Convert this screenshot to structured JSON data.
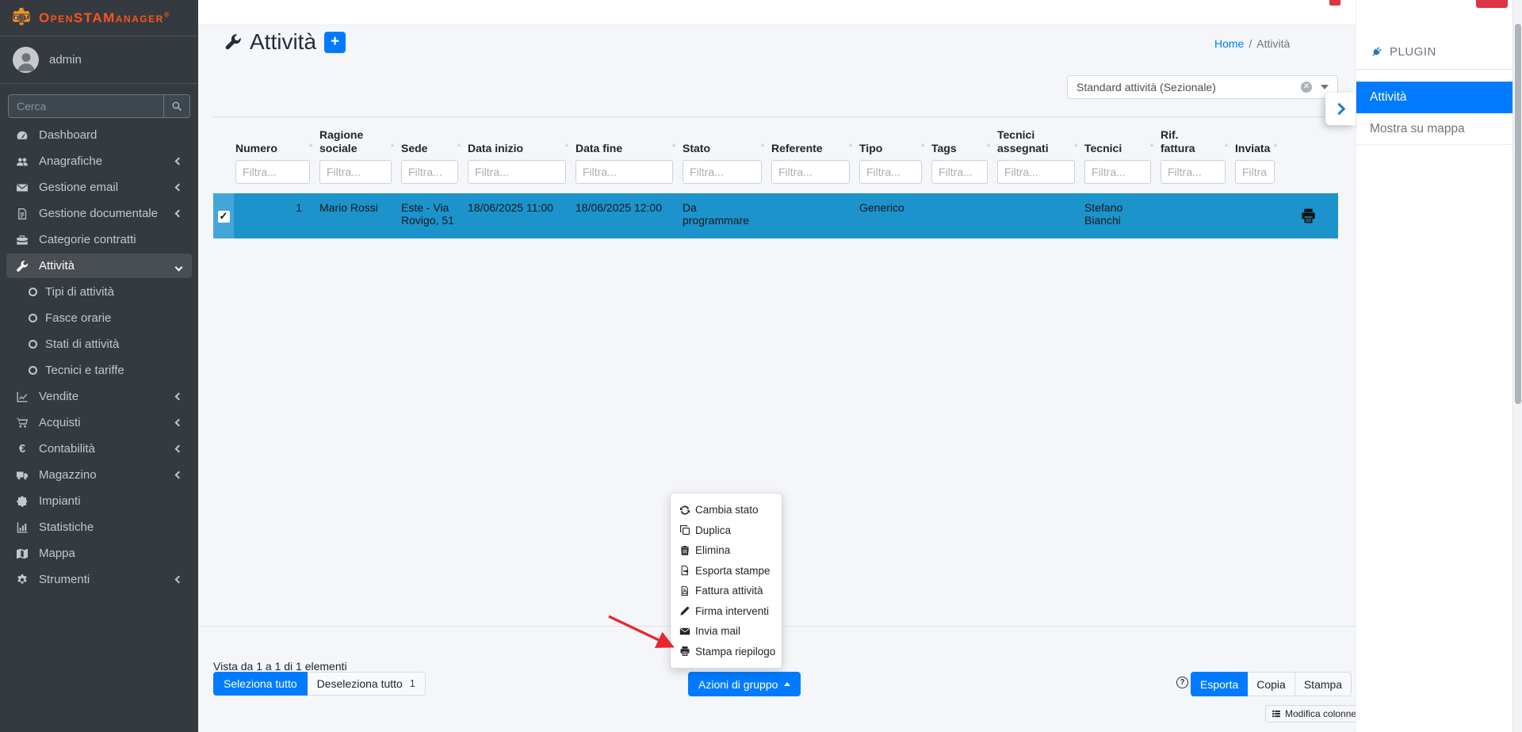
{
  "app": {
    "name": "OpenSTAManager",
    "reg": "®",
    "logo_abbr": "OSM"
  },
  "colors": {
    "primary": "#007bff",
    "sidebar_bg": "#343a40",
    "selected_row": "#1d93cc",
    "brand_orange": "#fb551c",
    "danger": "#dc3545"
  },
  "sidebar": {
    "user": "admin",
    "search_placeholder": "Cerca",
    "items": [
      {
        "label": "Dashboard",
        "icon": "tachometer-icon"
      },
      {
        "label": "Anagrafiche",
        "icon": "users-icon"
      },
      {
        "label": "Gestione email",
        "icon": "envelope-icon"
      },
      {
        "label": "Gestione documentale",
        "icon": "document-icon"
      },
      {
        "label": "Categorie contratti",
        "icon": "briefcase-icon"
      },
      {
        "label": "Attività",
        "icon": "wrench-icon",
        "active": true,
        "expanded": true,
        "children": [
          {
            "label": "Tipi di attività"
          },
          {
            "label": "Fasce orarie"
          },
          {
            "label": "Stati di attività"
          },
          {
            "label": "Tecnici e tariffe"
          }
        ]
      },
      {
        "label": "Vendite",
        "icon": "line-chart-icon"
      },
      {
        "label": "Acquisti",
        "icon": "cart-icon"
      },
      {
        "label": "Contabilità",
        "icon": "euro-icon"
      },
      {
        "label": "Magazzino",
        "icon": "truck-icon"
      },
      {
        "label": "Impianti",
        "icon": "puzzle-icon"
      },
      {
        "label": "Statistiche",
        "icon": "bar-chart-icon"
      },
      {
        "label": "Mappa",
        "icon": "map-icon"
      },
      {
        "label": "Strumenti",
        "icon": "gear-icon"
      }
    ]
  },
  "page": {
    "title": "Attività",
    "add_label": "+",
    "breadcrumb": {
      "home": "Home",
      "separator": "/",
      "current": "Attività"
    }
  },
  "report_select": {
    "value": "Standard attività (Sezionale)"
  },
  "table": {
    "filter_placeholder": "Filtra...",
    "columns": [
      {
        "label": "Numero"
      },
      {
        "label": "Ragione sociale"
      },
      {
        "label": "Sede"
      },
      {
        "label": "Data inizio"
      },
      {
        "label": "Data fine"
      },
      {
        "label": "Stato"
      },
      {
        "label": "Referente"
      },
      {
        "label": "Tipo"
      },
      {
        "label": "Tags"
      },
      {
        "label": "Tecnici assegnati"
      },
      {
        "label": "Tecnici"
      },
      {
        "label": "Rif. fattura"
      },
      {
        "label": "Inviata"
      }
    ],
    "row": {
      "selected": true,
      "numero": "1",
      "ragione_sociale": "Mario Rossi",
      "sede": "Este - Via Rovigo, 51",
      "data_inizio": "18/06/2025 11:00",
      "data_fine": "18/06/2025 12:00",
      "stato": "Da programmare",
      "referente": "",
      "tipo": "Generico",
      "tags": "",
      "tecnici_assegnati": "",
      "tecnici": "Stefano Bianchi",
      "rif_fattura": "",
      "inviata": ""
    },
    "info": "Vista da 1 a 1 di 1 elementi"
  },
  "footer": {
    "select_all": "Seleziona tutto",
    "deselect_all": "Deseleziona tutto",
    "deselect_count": "1",
    "group_actions": "Azioni di gruppo",
    "help_label": "?",
    "export": "Esporta",
    "copy": "Copia",
    "print": "Stampa",
    "edit_columns": "Modifica colonne"
  },
  "group_menu": {
    "items": [
      {
        "label": "Cambia stato",
        "icon": "sync-icon"
      },
      {
        "label": "Duplica",
        "icon": "clone-icon"
      },
      {
        "label": "Elimina",
        "icon": "trash-icon"
      },
      {
        "label": "Esporta stampe",
        "icon": "file-export-icon"
      },
      {
        "label": "Fattura attività",
        "icon": "file-invoice-icon"
      },
      {
        "label": "Firma interventi",
        "icon": "pen-icon"
      },
      {
        "label": "Invia mail",
        "icon": "envelope-icon"
      },
      {
        "label": "Stampa riepilogo",
        "icon": "print-icon"
      }
    ]
  },
  "plugin_panel": {
    "header": "PLUGIN",
    "items": [
      {
        "label": "Attività",
        "active": true
      },
      {
        "label": "Mostra su mappa"
      }
    ]
  }
}
